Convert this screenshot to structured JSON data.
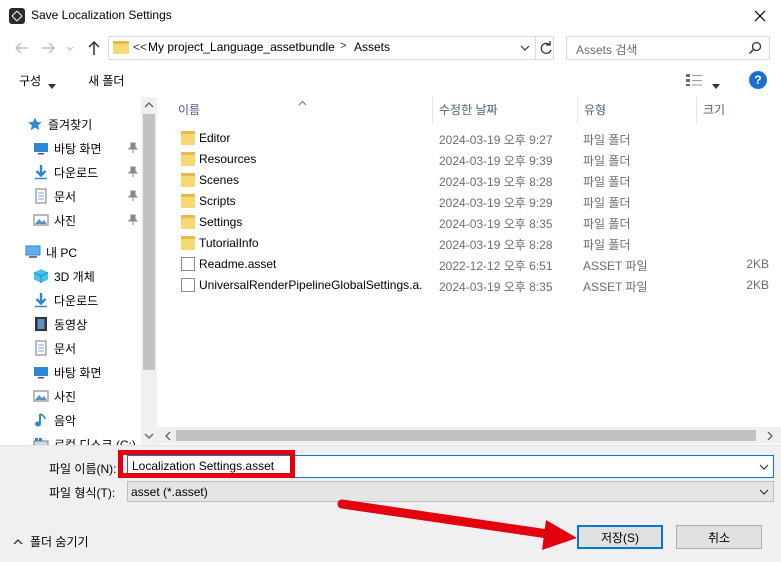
{
  "window": {
    "title": "Save Localization Settings"
  },
  "address": {
    "overflow": "<<",
    "crumbs": [
      "My project_Language_assetbundle",
      "Assets"
    ],
    "separator": ">"
  },
  "search": {
    "placeholder": "Assets 검색"
  },
  "toolbar": {
    "organize": "구성",
    "new_folder": "새 폴더",
    "help": "?"
  },
  "sidebar": {
    "items": [
      {
        "label": "즐겨찾기",
        "icon": "star-icon"
      },
      {
        "label": "바탕 화면",
        "icon": "desktop-icon",
        "pinned": true
      },
      {
        "label": "다운로드",
        "icon": "download-icon",
        "pinned": true
      },
      {
        "label": "문서",
        "icon": "document-icon",
        "pinned": true
      },
      {
        "label": "사진",
        "icon": "picture-icon",
        "pinned": true
      },
      {
        "label": "내 PC",
        "icon": "pc-icon"
      },
      {
        "label": "3D 개체",
        "icon": "cube-icon"
      },
      {
        "label": "다운로드",
        "icon": "download-icon"
      },
      {
        "label": "동영상",
        "icon": "video-icon"
      },
      {
        "label": "문서",
        "icon": "document-icon"
      },
      {
        "label": "바탕 화면",
        "icon": "desktop-icon"
      },
      {
        "label": "사진",
        "icon": "picture-icon"
      },
      {
        "label": "음악",
        "icon": "music-icon"
      },
      {
        "label": "로컬 디스크 (C:)",
        "icon": "disk-icon"
      }
    ]
  },
  "columns": {
    "name": "이름",
    "modified": "수정한 날짜",
    "type": "유형",
    "size": "크기"
  },
  "files": [
    {
      "name": "Editor",
      "modified": "2024-03-19 오후 9:27",
      "type": "파일 폴더",
      "size": "",
      "kind": "folder"
    },
    {
      "name": "Resources",
      "modified": "2024-03-19 오후 9:39",
      "type": "파일 폴더",
      "size": "",
      "kind": "folder"
    },
    {
      "name": "Scenes",
      "modified": "2024-03-19 오후 8:28",
      "type": "파일 폴더",
      "size": "",
      "kind": "folder"
    },
    {
      "name": "Scripts",
      "modified": "2024-03-19 오후 9:29",
      "type": "파일 폴더",
      "size": "",
      "kind": "folder"
    },
    {
      "name": "Settings",
      "modified": "2024-03-19 오후 8:35",
      "type": "파일 폴더",
      "size": "",
      "kind": "folder"
    },
    {
      "name": "TutorialInfo",
      "modified": "2024-03-19 오후 8:28",
      "type": "파일 폴더",
      "size": "",
      "kind": "folder"
    },
    {
      "name": "Readme.asset",
      "modified": "2022-12-12 오후 6:51",
      "type": "ASSET 파일",
      "size": "2KB",
      "kind": "file"
    },
    {
      "name": "UniversalRenderPipelineGlobalSettings.a...",
      "modified": "2024-03-19 오후 8:35",
      "type": "ASSET 파일",
      "size": "2KB",
      "kind": "file"
    }
  ],
  "form": {
    "filename_label": "파일 이름(N):",
    "filename_value": "Localization Settings.asset",
    "filetype_label": "파일 형식(T):",
    "filetype_value": "asset (*.asset)"
  },
  "footer": {
    "hide_folders": "폴더 숨기기",
    "save": "저장(S)",
    "cancel": "취소"
  },
  "colors": {
    "accent": "#0078d7",
    "annotation": "#e3000f",
    "folder": "#f8d775"
  }
}
